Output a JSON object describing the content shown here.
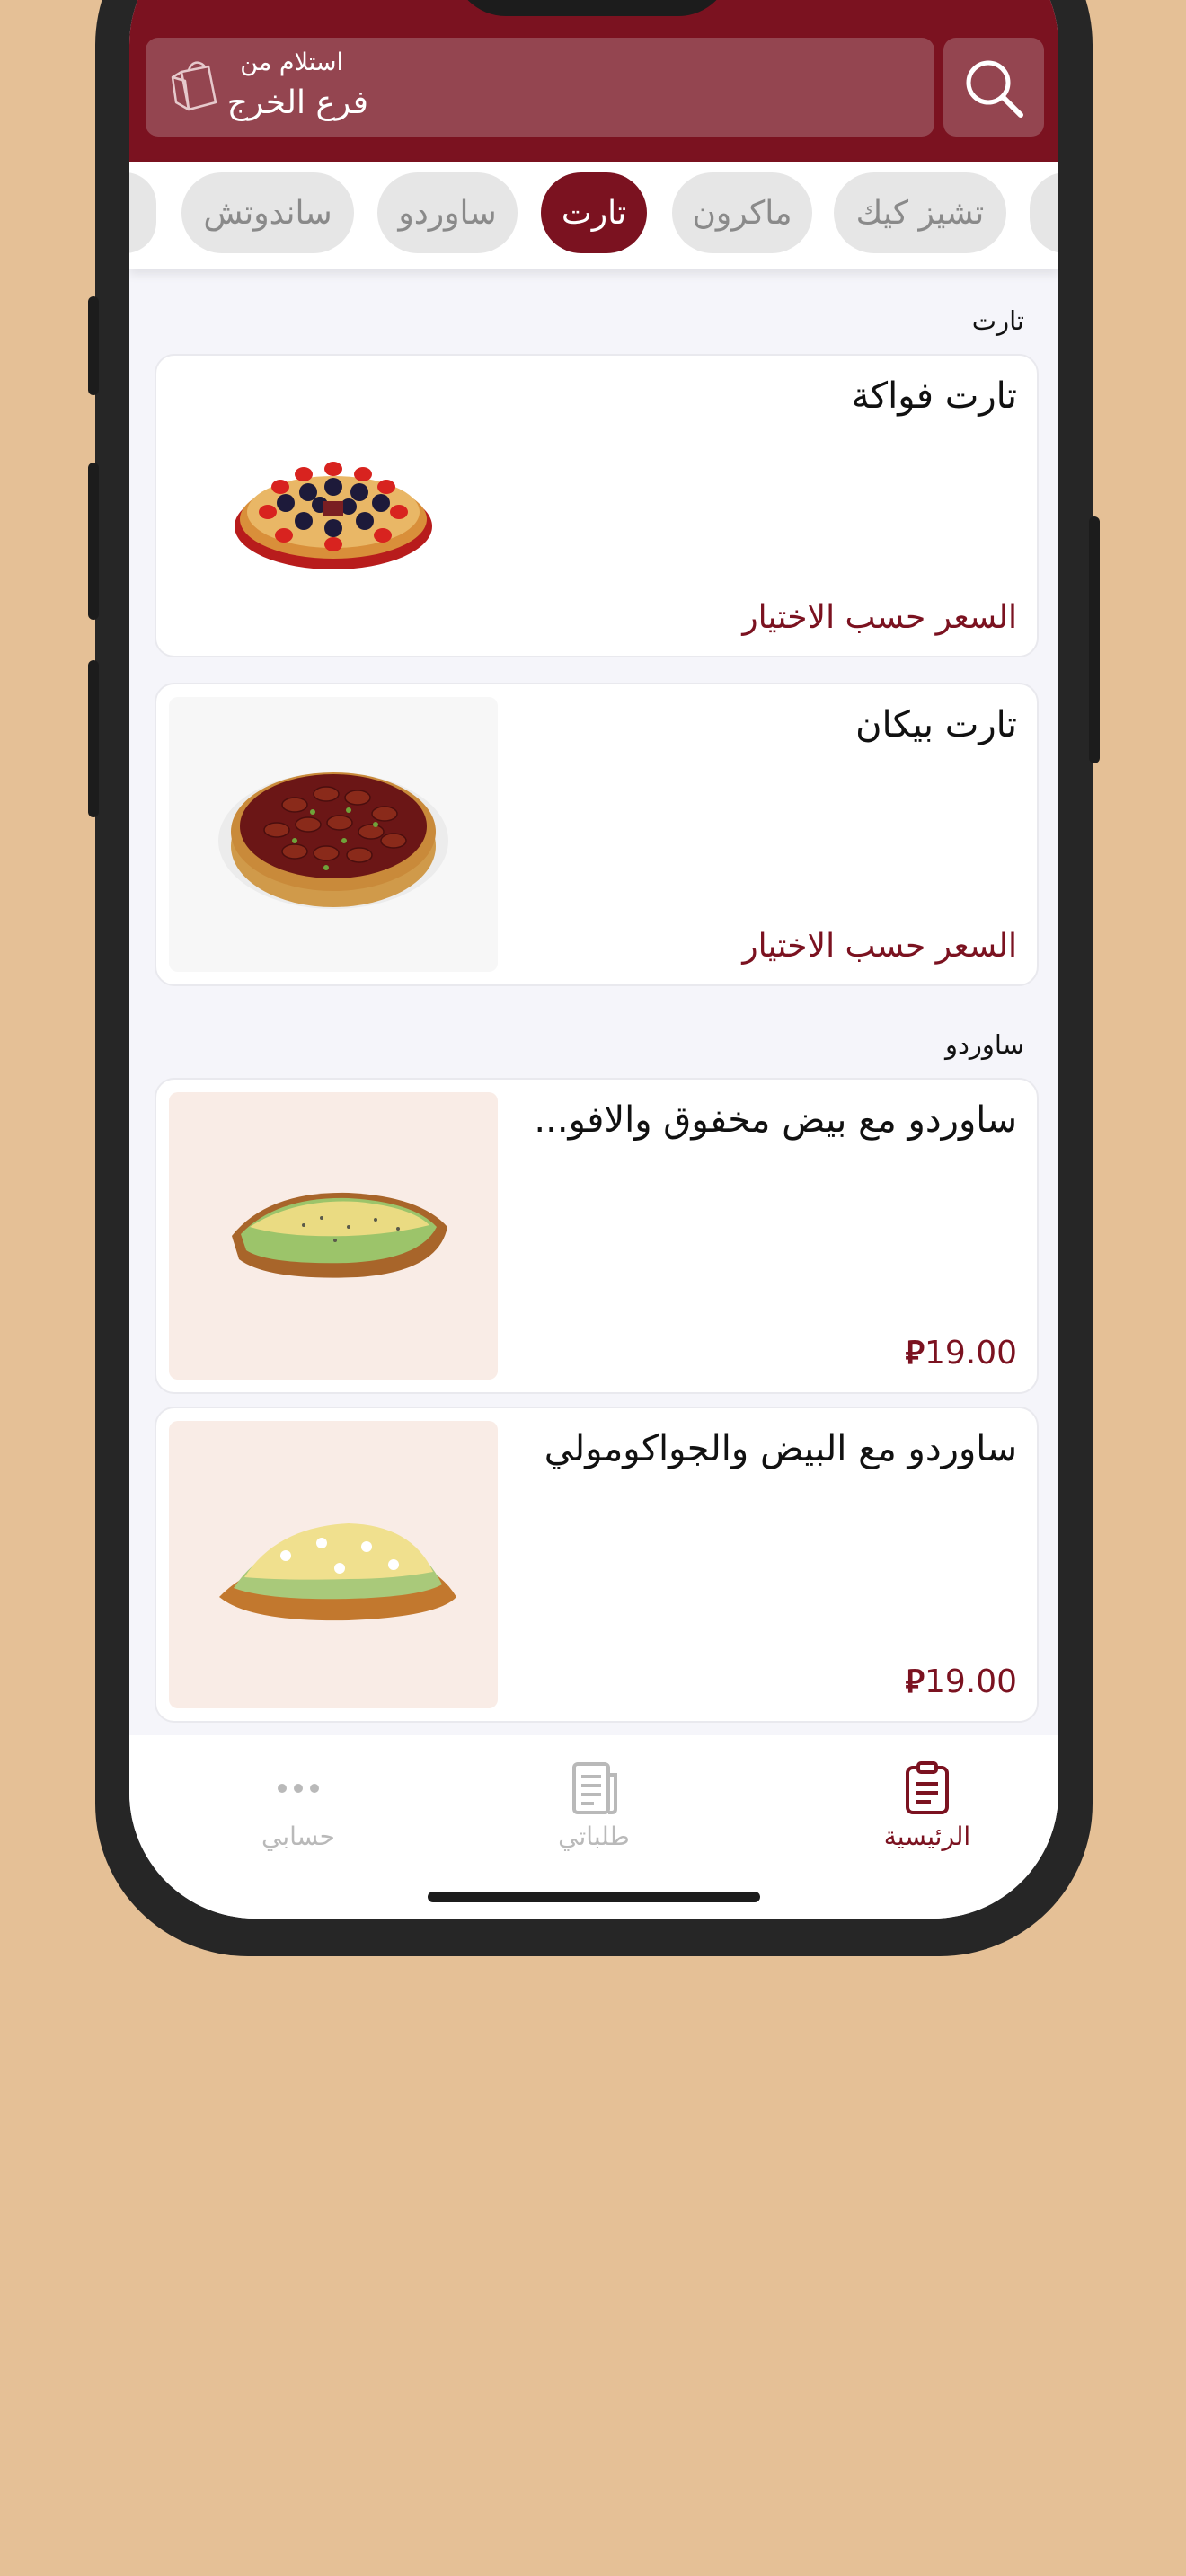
{
  "header": {
    "pickup_label": "استلام من",
    "pickup_branch": "فرع الخرج"
  },
  "category_tabs": [
    {
      "label": "ساندوتش",
      "active": false
    },
    {
      "label": "ساوردو",
      "active": false
    },
    {
      "label": "تارت",
      "active": true
    },
    {
      "label": "ماكرون",
      "active": false
    },
    {
      "label": "تشيز كيك",
      "active": false
    }
  ],
  "sections": [
    {
      "title": "تارت",
      "items": [
        {
          "name": "تارت فواكة",
          "price": "السعر حسب الاختيار",
          "image": "fruit-tart"
        },
        {
          "name": "تارت بيكان",
          "price": "السعر حسب الاختيار",
          "image": "pecan-tart"
        }
      ]
    },
    {
      "title": "ساوردو",
      "items": [
        {
          "name": "ساوردو مع بيض مخفوق والافو...",
          "price": "19.00",
          "currency_icon": "riyal-symbol",
          "image": "sourdough-avocado"
        },
        {
          "name": "ساوردو مع البيض والجواكومولي",
          "price": "19.00",
          "currency_icon": "riyal-symbol",
          "image": "sourdough-guacamole"
        }
      ]
    }
  ],
  "bottom_nav": [
    {
      "label": "الرئيسية",
      "icon": "clipboard-icon",
      "active": true
    },
    {
      "label": "طلباتي",
      "icon": "receipt-icon",
      "active": false
    },
    {
      "label": "حسابي",
      "icon": "more-dots-icon",
      "active": false
    }
  ],
  "colors": {
    "brand": "#7b1220",
    "background": "#e5c096",
    "inactive": "#b9b9b9"
  }
}
